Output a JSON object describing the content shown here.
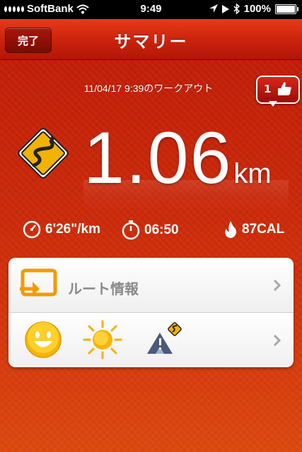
{
  "status_bar": {
    "carrier": "SoftBank",
    "time": "9:49",
    "battery": "100%"
  },
  "nav": {
    "title": "サマリー",
    "done_label": "完了"
  },
  "summary": {
    "workout_date": "11/04/17 9:39のワークアウト",
    "like_count": "1",
    "distance_value": "1.06",
    "distance_unit": "km",
    "pace": "6'26\"/km",
    "duration": "06:50",
    "calories": "87CAL"
  },
  "card": {
    "route_label": "ルート情報"
  },
  "colors": {
    "accent_red": "#c72108",
    "card_bg": "#ffffff",
    "label_gray": "#8a8a8a"
  }
}
